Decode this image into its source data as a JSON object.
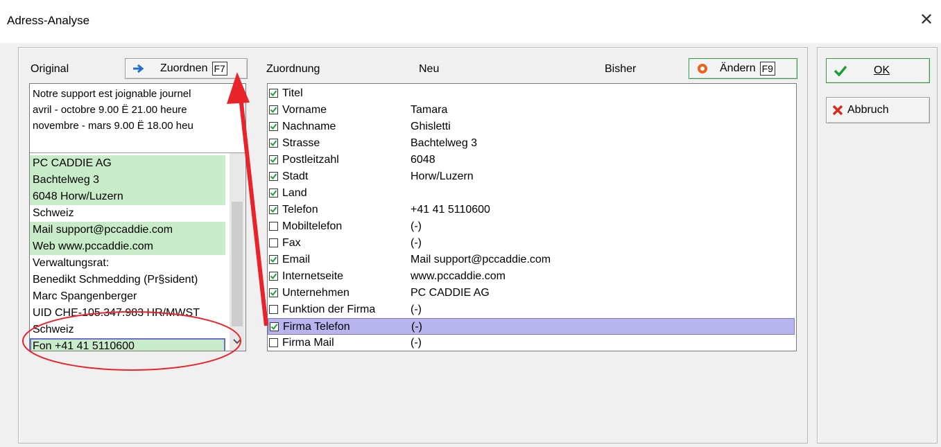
{
  "window": {
    "title": "Adress-Analyse",
    "close_glyph": "✕"
  },
  "original": {
    "header": "Original",
    "assign_button": {
      "label": "Zuordnen",
      "key": "F7",
      "icon": "arrow-right-icon"
    },
    "text_lines": [
      "Notre support est joignable journel",
      "avril - octobre 9.00 Ë 21.00 heure",
      "novembre - mars 9.00 Ë 18.00 heu"
    ],
    "lines": [
      {
        "text": "PC CADDIE AG",
        "highlight": true
      },
      {
        "text": "Bachtelweg 3",
        "highlight": true
      },
      {
        "text": "6048 Horw/Luzern",
        "highlight": true
      },
      {
        "text": "Schweiz",
        "highlight": false
      },
      {
        "text": "Mail support@pccaddie.com",
        "highlight": true
      },
      {
        "text": "Web www.pccaddie.com",
        "highlight": true
      },
      {
        "text": "Verwaltungsrat:",
        "highlight": false
      },
      {
        "text": "Benedikt Schmedding (Pr§sident)",
        "highlight": false
      },
      {
        "text": "Marc Spangenberger",
        "highlight": false
      },
      {
        "text": "UID CHE-105.347.983 HR/MWST",
        "highlight": false
      },
      {
        "text": "Schweiz",
        "highlight": false
      },
      {
        "text": "Fon +41 41 5110600",
        "highlight": true
      }
    ]
  },
  "mapping": {
    "headers": {
      "assignment": "Zuordnung",
      "new": "Neu",
      "previous": "Bisher"
    },
    "change_button": {
      "label": "Ändern",
      "key": "F9",
      "icon": "change-icon"
    },
    "rows": [
      {
        "field": "Titel",
        "checked": true,
        "value": ""
      },
      {
        "field": "Vorname",
        "checked": true,
        "value": "Tamara"
      },
      {
        "field": "Nachname",
        "checked": true,
        "value": "Ghisletti"
      },
      {
        "field": "Strasse",
        "checked": true,
        "value": "Bachtelweg 3"
      },
      {
        "field": "Postleitzahl",
        "checked": true,
        "value": "6048"
      },
      {
        "field": "Stadt",
        "checked": true,
        "value": "Horw/Luzern"
      },
      {
        "field": "Land",
        "checked": true,
        "value": ""
      },
      {
        "field": "Telefon",
        "checked": true,
        "value": "+41 41 5110600"
      },
      {
        "field": "Mobiltelefon",
        "checked": false,
        "value": "(-)"
      },
      {
        "field": "Fax",
        "checked": false,
        "value": "(-)"
      },
      {
        "field": "Email",
        "checked": true,
        "value": "Mail support@pccaddie.com"
      },
      {
        "field": "Internetseite",
        "checked": true,
        "value": "www.pccaddie.com"
      },
      {
        "field": "Unternehmen",
        "checked": true,
        "value": "PC CADDIE AG"
      },
      {
        "field": "Funktion der Firma",
        "checked": false,
        "value": "(-)"
      },
      {
        "field": "Firma Telefon",
        "checked": true,
        "value": "(-)",
        "selected": true
      },
      {
        "field": "Firma Mail",
        "checked": false,
        "value": "(-)"
      }
    ]
  },
  "actions": {
    "ok": {
      "label": "OK",
      "icon": "checkmark-icon"
    },
    "cancel": {
      "label": "Abbruch",
      "icon": "x-icon"
    }
  },
  "colors": {
    "highlight_green": "#c8ecc8",
    "selected_row": "#b7b4ee",
    "annotation_red": "#e8232a",
    "button_border_green": "#2f9c3b"
  }
}
